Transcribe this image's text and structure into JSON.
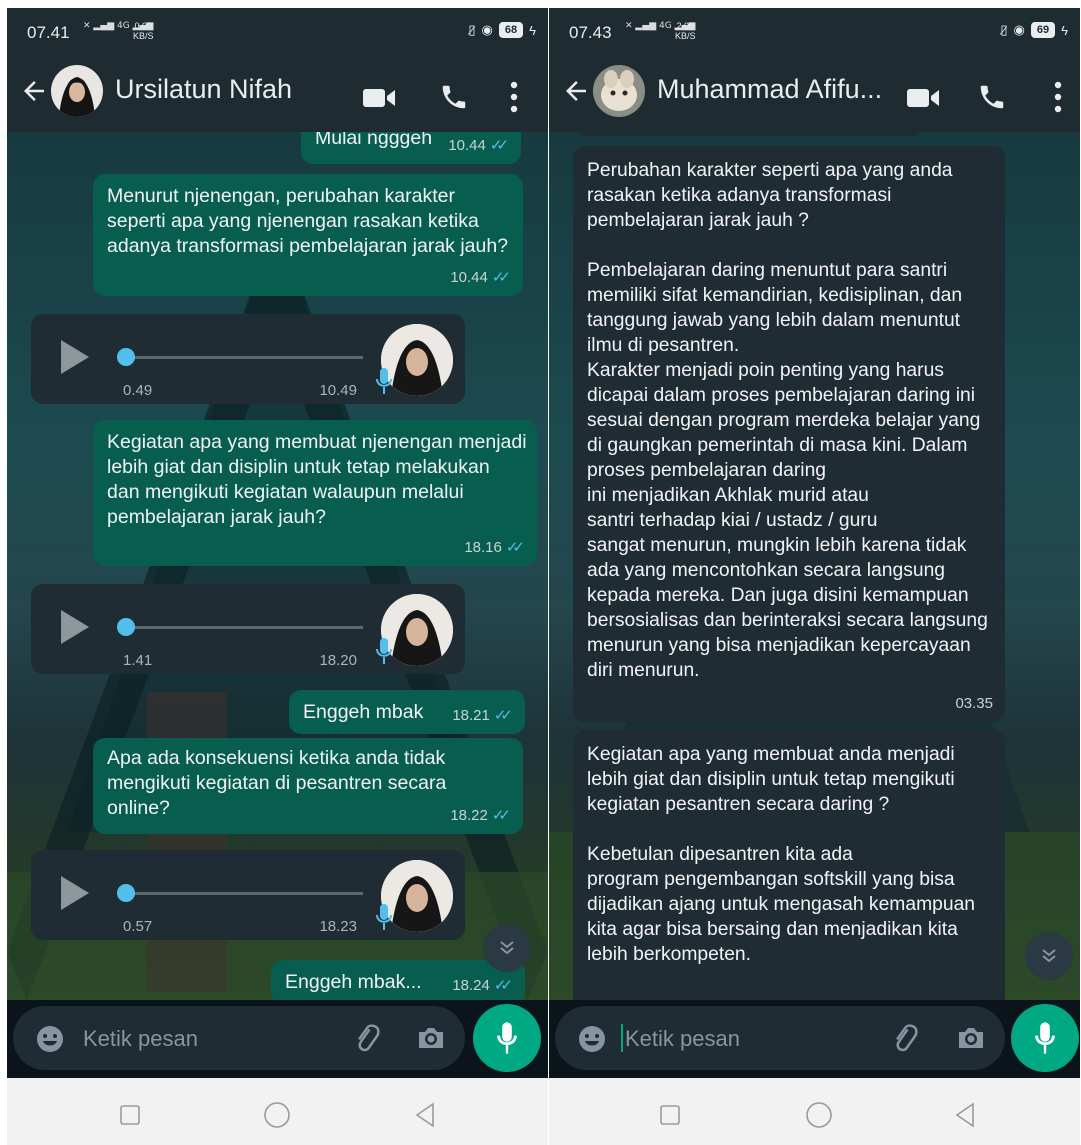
{
  "left": {
    "status": {
      "time": "07.41",
      "net": "4G",
      "speed_value": "0.00",
      "speed_unit": "KB/S",
      "battery": "68"
    },
    "contact": "Ursilatun Nifah",
    "messages": [
      {
        "text": "Mulai ngggeh",
        "time": "10.44"
      },
      {
        "text": "Menurut njenengan, perubahan karakter seperti apa yang njenengan rasakan ketika adanya transformasi pembelajaran jarak jauh?",
        "time": "10.44"
      },
      {
        "text": "Kegiatan apa yang membuat njenengan menjadi lebih giat dan disiplin untuk tetap melakukan dan mengikuti kegiatan walaupun melalui pembelajaran jarak jauh?",
        "time": "18.16"
      },
      {
        "text": "Enggeh mbak",
        "time": "18.21"
      },
      {
        "text": "Apa ada konsekuensi ketika anda tidak mengikuti kegiatan di pesantren secara online?",
        "time": "18.22"
      },
      {
        "text": "Enggeh mbak...",
        "time": "18.24"
      }
    ],
    "voices": [
      {
        "duration": "0.49",
        "time": "10.49"
      },
      {
        "duration": "1.41",
        "time": "18.20"
      },
      {
        "duration": "0.57",
        "time": "18.23"
      }
    ],
    "input_placeholder": "Ketik pesan"
  },
  "right": {
    "status": {
      "time": "07.43",
      "net": "4G",
      "speed_value": "2.00",
      "speed_unit": "KB/S",
      "battery": "69"
    },
    "contact": "Muhammad Afifu...",
    "messages": [
      {
        "text": "Perubahan karakter seperti apa yang anda rasakan ketika adanya transformasi pembelajaran jarak jauh ?\n\nPembelajaran daring menuntut para santri memiliki sifat kemandirian, kedisiplinan, dan tanggung jawab yang lebih dalam menuntut ilmu di pesantren.\nKarakter menjadi poin penting yang harus dicapai dalam proses pembelajaran daring ini sesuai dengan program merdeka belajar yang di gaungkan pemerintah di masa kini. Dalam proses pembelajaran daring\nini menjadikan Akhlak murid atau\nsantri  terhadap kiai / ustadz / guru\nsangat menurun, mungkin lebih karena tidak ada yang mencontohkan secara langsung kepada mereka. Dan juga disini kemampuan bersosialisas dan berinteraksi secara langsung menurun yang bisa menjadikan kepercayaan diri menurun.",
        "time": "03.35"
      },
      {
        "text": "Kegiatan apa yang membuat anda menjadi lebih giat dan disiplin untuk tetap mengikuti kegiatan pesantren secara daring ?\n\nKebetulan dipesantren kita ada\nprogram pengembangan softskill yang bisa dijadikan ajang untuk mengasah kemampuan kita agar bisa bersaing dan menjadikan kita lebih berkompeten."
      }
    ],
    "input_placeholder": "Ketik pesan"
  },
  "colors": {
    "outgoing": "#075e4f",
    "incoming": "#1f2c33",
    "header": "#1e2b31",
    "accent": "#00a884",
    "tick": "#53bdeb"
  }
}
